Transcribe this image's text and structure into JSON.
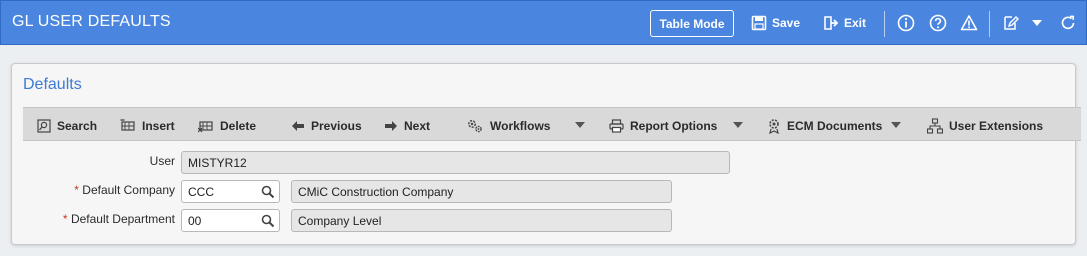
{
  "header": {
    "title": "GL USER DEFAULTS",
    "table_mode": "Table Mode",
    "save": "Save",
    "exit": "Exit",
    "icons": [
      "info-icon",
      "help-icon",
      "warning-icon",
      "edit-icon",
      "chevron-down-icon",
      "refresh-icon"
    ]
  },
  "panel": {
    "title": "Defaults"
  },
  "toolbar": {
    "search": "Search",
    "insert": "Insert",
    "delete": "Delete",
    "previous": "Previous",
    "next": "Next",
    "workflows": "Workflows",
    "report_options": "Report Options",
    "ecm_documents": "ECM Documents",
    "user_extensions": "User Extensions"
  },
  "form": {
    "required_marker": "*",
    "user_label": "User",
    "user_value": "MISTYR12",
    "company_label": "Default Company",
    "company_code": "CCC",
    "company_name": "CMiC Construction Company",
    "department_label": "Default Department",
    "department_code": "00",
    "department_name": "Company Level"
  },
  "colors": {
    "header_bg": "#4a86e0",
    "section_title": "#3d7ad6",
    "toolbar_bg": "#d9d9d9"
  }
}
